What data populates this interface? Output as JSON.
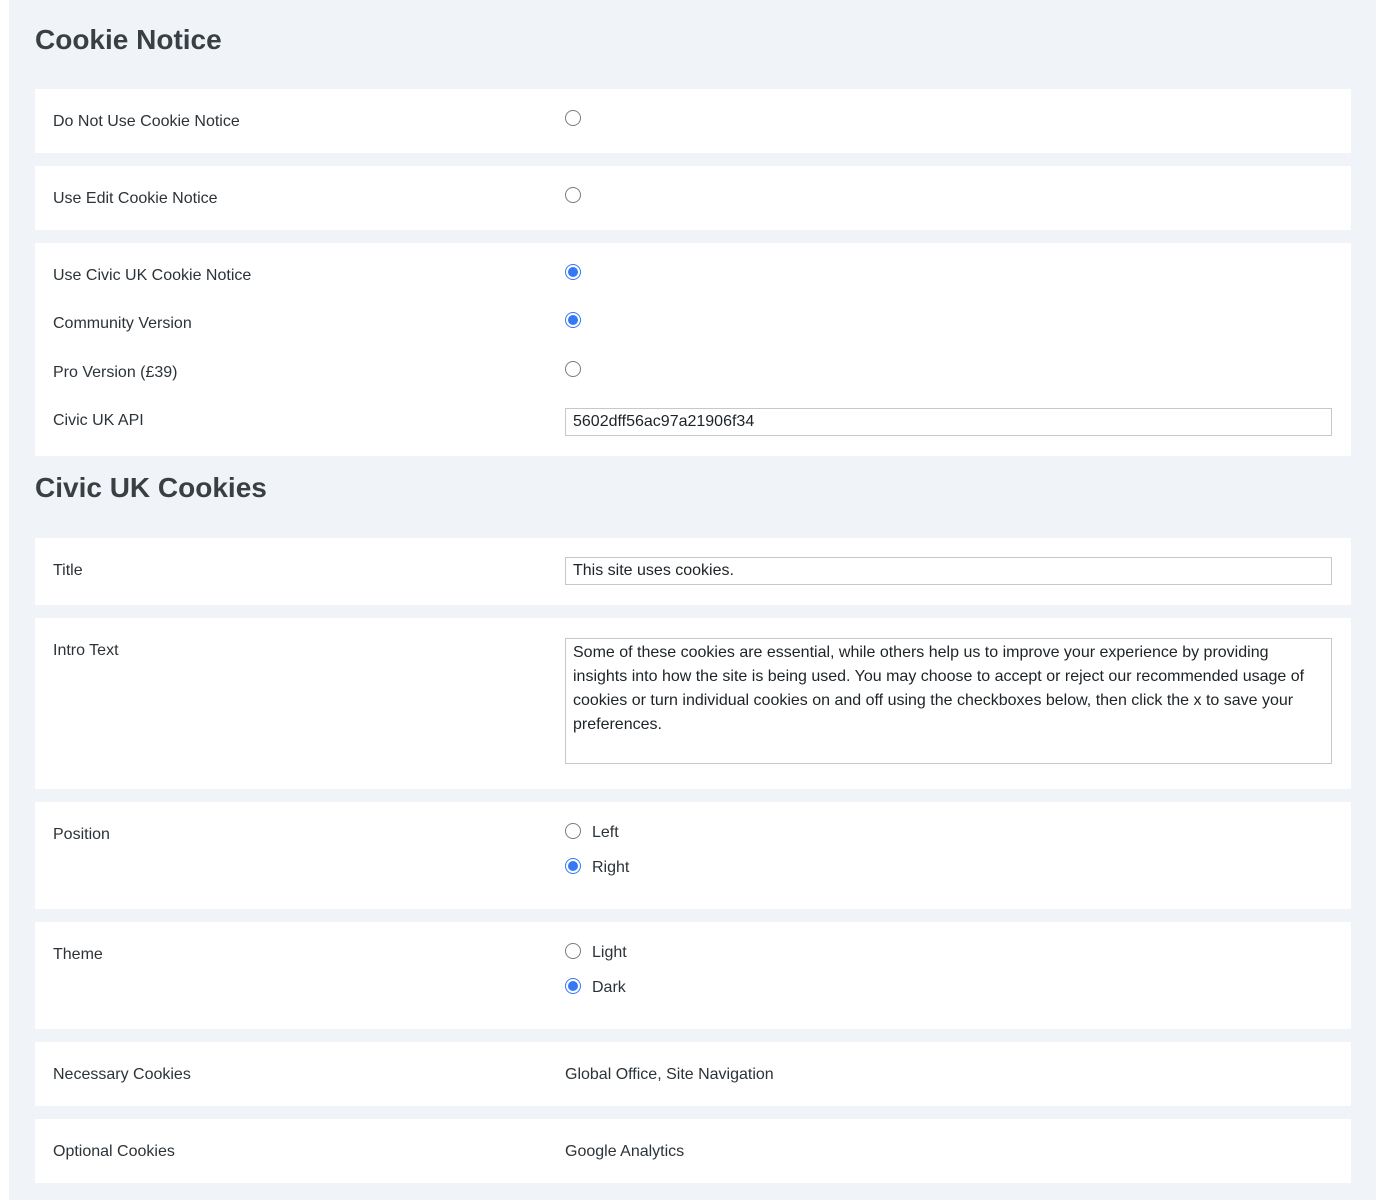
{
  "cookie_notice": {
    "heading": "Cookie Notice",
    "do_not_use": {
      "label": "Do Not Use Cookie Notice",
      "checked": false
    },
    "use_edit": {
      "label": "Use Edit Cookie Notice",
      "checked": false
    },
    "use_civic": {
      "label": "Use Civic UK Cookie Notice",
      "checked": true
    },
    "community_version": {
      "label": "Community Version",
      "checked": true
    },
    "pro_version": {
      "label": "Pro Version (£39)",
      "checked": false
    },
    "civic_api": {
      "label": "Civic UK API",
      "value": "5602dff56ac97a21906f34"
    }
  },
  "civic_cookies": {
    "heading": "Civic UK Cookies",
    "title": {
      "label": "Title",
      "value": "This site uses cookies."
    },
    "intro_text": {
      "label": "Intro Text",
      "value": "Some of these cookies are essential, while others help us to improve your experience by providing insights into how the site is being used. You may choose to accept or reject our recommended usage of cookies or turn individual cookies on and off using the checkboxes below, then click the x to save your preferences."
    },
    "position": {
      "label": "Position",
      "options": [
        {
          "label": "Left",
          "checked": false
        },
        {
          "label": "Right",
          "checked": true
        }
      ]
    },
    "theme": {
      "label": "Theme",
      "options": [
        {
          "label": "Light",
          "checked": false
        },
        {
          "label": "Dark",
          "checked": true
        }
      ]
    },
    "necessary_cookies": {
      "label": "Necessary Cookies",
      "value": "Global Office, Site Navigation"
    },
    "optional_cookies": {
      "label": "Optional Cookies",
      "value": "Google Analytics"
    }
  },
  "colors": {
    "page_background": "#f0f4f9",
    "panel_background": "#ffffff",
    "radio_accent": "#3478f6",
    "text": "#2c3338"
  }
}
